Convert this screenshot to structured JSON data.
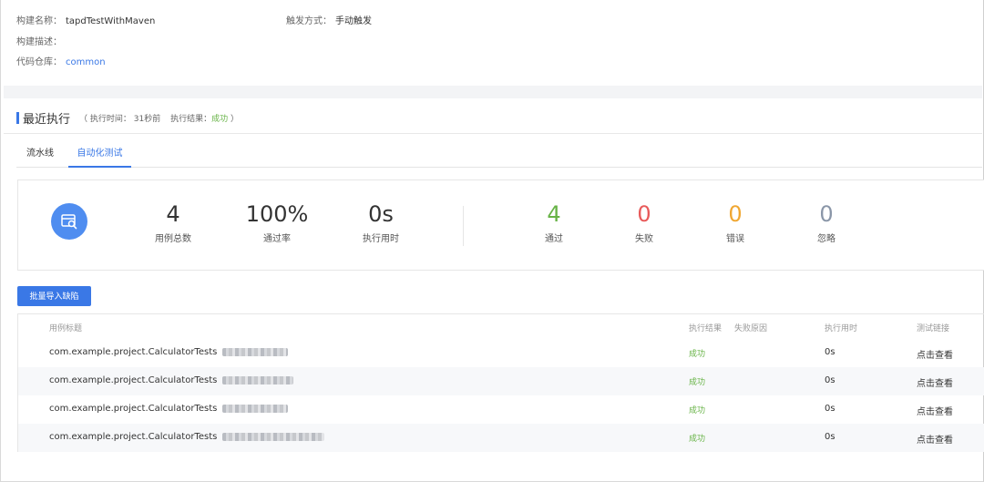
{
  "info": {
    "build_name_label": "构建名称：",
    "build_name": "tapdTestWithMaven",
    "trigger_label": "触发方式：",
    "trigger": "手动触发",
    "desc_label": "构建描述：",
    "desc": "",
    "repo_label": "代码仓库：",
    "repo": "common"
  },
  "recent": {
    "title": "最近执行",
    "meta_prefix": "（ 执行时间： 31秒前",
    "result_label": "执行结果：",
    "result": "成功",
    "meta_suffix": "）"
  },
  "tabs": [
    {
      "label": "流水线",
      "active": false
    },
    {
      "label": "自动化测试",
      "active": true
    }
  ],
  "stats": [
    {
      "value": "4",
      "label": "用例总数",
      "color": "#333333"
    },
    {
      "value": "100%",
      "label": "通过率",
      "color": "#333333"
    },
    {
      "value": "0s",
      "label": "执行用时",
      "color": "#333333"
    },
    {
      "value": "4",
      "label": "通过",
      "color": "#67b346"
    },
    {
      "value": "0",
      "label": "失败",
      "color": "#e85a5a"
    },
    {
      "value": "0",
      "label": "错误",
      "color": "#f0a732"
    },
    {
      "value": "0",
      "label": "忽略",
      "color": "#8a96a8"
    }
  ],
  "batch_button": "批量导入缺陷",
  "table": {
    "headers": [
      "用例标题",
      "执行结果",
      "失败原因",
      "执行用时",
      "测试链接"
    ],
    "rows": [
      {
        "title": "com.example.project.CalculatorTests",
        "result": "成功",
        "reason": "",
        "time": "0s",
        "link": "点击查看"
      },
      {
        "title": "com.example.project.CalculatorTests",
        "result": "成功",
        "reason": "",
        "time": "0s",
        "link": "点击查看"
      },
      {
        "title": "com.example.project.CalculatorTests",
        "result": "成功",
        "reason": "",
        "time": "0s",
        "link": "点击查看"
      },
      {
        "title": "com.example.project.CalculatorTests",
        "result": "成功",
        "reason": "",
        "time": "0s",
        "link": "点击查看"
      }
    ]
  },
  "colors": {
    "accent": "#3a78e6",
    "success": "#67b346"
  },
  "icons": {
    "stats_icon": "test-report-search-icon"
  }
}
